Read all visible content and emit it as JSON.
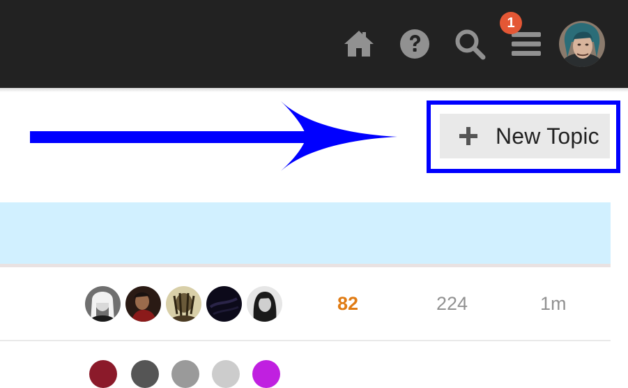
{
  "header": {
    "notification_count": "1",
    "icons": [
      "home-icon",
      "question-circle-icon",
      "search-icon",
      "hamburger-menu-icon"
    ],
    "colors": {
      "background": "#222222",
      "icon": "#919191",
      "badge": "#e45735"
    }
  },
  "actions": {
    "new_topic_label": "New Topic",
    "highlight_color": "#0000ff"
  },
  "topic_list": {
    "rows": [
      {
        "replies": "82",
        "views": "224",
        "activity": "1m"
      }
    ],
    "colors": {
      "replies_hot": "#e07b13",
      "muted": "#919191",
      "banner": "#d1f0ff"
    }
  }
}
